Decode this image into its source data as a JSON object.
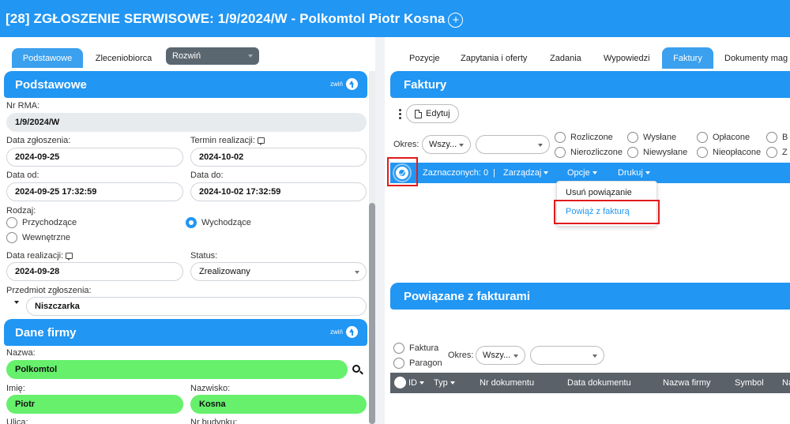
{
  "header": {
    "title": "[28] ZGŁOSZENIE SERWISOWE: 1/9/2024/W - Polkomtol Piotr Kosna"
  },
  "left_tabs": {
    "podstawowe": "Podstawowe",
    "zleceniobiorca": "Zleceniobiorca",
    "rozwin": "Rozwiń"
  },
  "section_basic": {
    "title": "Podstawowe",
    "collapse": "zwiń",
    "rma_label": "Nr RMA:",
    "rma_value": "1/9/2024/W",
    "date_report_label": "Data zgłoszenia:",
    "date_report_value": "2024-09-25",
    "deadline_label": "Termin realizacji:",
    "deadline_value": "2024-10-02",
    "date_from_label": "Data od:",
    "date_from_value": "2024-09-25 17:32:59",
    "date_to_label": "Data do:",
    "date_to_value": "2024-10-02 17:32:59",
    "type_label": "Rodzaj:",
    "type_incoming": "Przychodzące",
    "type_outgoing": "Wychodzące",
    "type_internal": "Wewnętrzne",
    "realization_label": "Data realizacji:",
    "realization_value": "2024-09-28",
    "status_label": "Status:",
    "status_value": "Zrealizowany",
    "subject_label": "Przedmiot zgłoszenia:",
    "subject_value": "Niszczarka"
  },
  "section_company": {
    "title": "Dane firmy",
    "collapse": "zwiń",
    "name_label": "Nazwa:",
    "name_value": "Polkomtol",
    "first_label": "Imię:",
    "first_value": "Piotr",
    "last_label": "Nazwisko:",
    "last_value": "Kosna",
    "street_label": "Ulica:",
    "building_label": "Nr budynku:"
  },
  "right_tabs": [
    "Pozycje",
    "Zapytania i oferty",
    "Zadania",
    "Wypowiedzi",
    "Faktury",
    "Dokumenty mag"
  ],
  "invoices": {
    "title": "Faktury",
    "edit_button": "Edytuj",
    "period_label": "Okres:",
    "period_value": "Wszy...",
    "filters_row1": [
      "Rozliczone",
      "Wysłane",
      "Opłacone",
      "B"
    ],
    "filters_row2": [
      "Nierozliczone",
      "Niewysłane",
      "Nieopłacone",
      "Z"
    ],
    "selected": "Zaznaczonych: 0",
    "manage": "Zarządzaj",
    "options": "Opcje",
    "print": "Drukuj",
    "menu": [
      "Usuń powiązanie",
      "Powiąż z fakturą"
    ]
  },
  "linked": {
    "title": "Powiązane z fakturami",
    "type_invoice": "Faktura",
    "type_receipt": "Paragon",
    "period_label": "Okres:",
    "period_value": "Wszy...",
    "columns": [
      "ID",
      "Typ",
      "Nr dokumentu",
      "Data dokumentu",
      "Nazwa firmy",
      "Symbol",
      "Na"
    ]
  },
  "colors": {
    "primary": "#2196f3",
    "highlight_green": "#66f06c",
    "annotation_red": "#e01b1b",
    "table_header": "#5a6169"
  }
}
